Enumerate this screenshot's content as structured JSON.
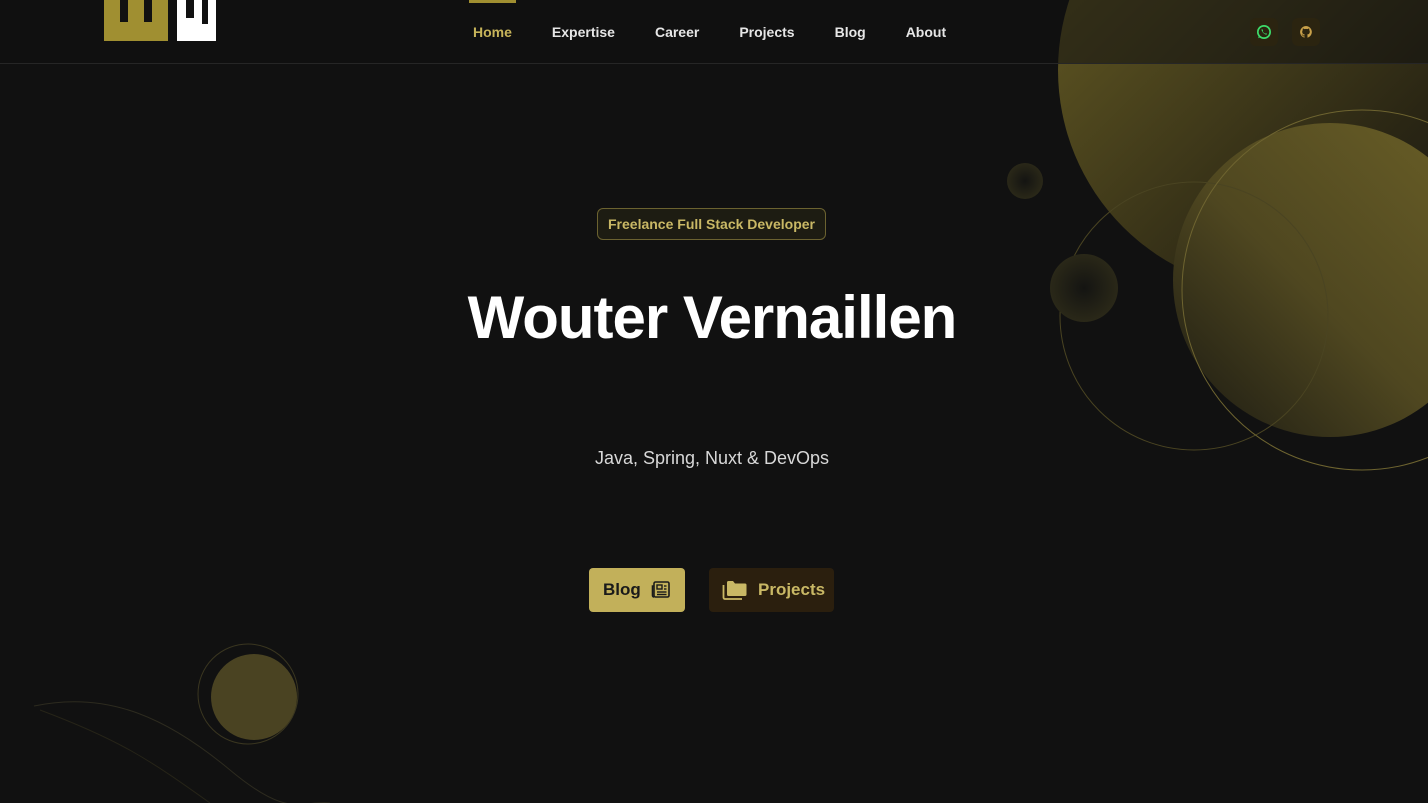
{
  "header": {
    "nav": [
      {
        "label": "Home",
        "active": true
      },
      {
        "label": "Expertise",
        "active": false
      },
      {
        "label": "Career",
        "active": false
      },
      {
        "label": "Projects",
        "active": false
      },
      {
        "label": "Blog",
        "active": false
      },
      {
        "label": "About",
        "active": false
      }
    ],
    "social": [
      {
        "icon": "whatsapp-icon",
        "color": "#3ddc6a"
      },
      {
        "icon": "github-icon",
        "color": "#c9a14a"
      }
    ]
  },
  "hero": {
    "badge": "Freelance Full Stack Developer",
    "title": "Wouter Vernaillen",
    "subtitle": "Java, Spring, Nuxt & DevOps",
    "buttons": {
      "blog": "Blog",
      "projects": "Projects"
    }
  },
  "colors": {
    "accent": "#c2b05a",
    "accent_dark": "#a08f31",
    "background": "#111111",
    "button_dark": "#2b1f0e"
  }
}
